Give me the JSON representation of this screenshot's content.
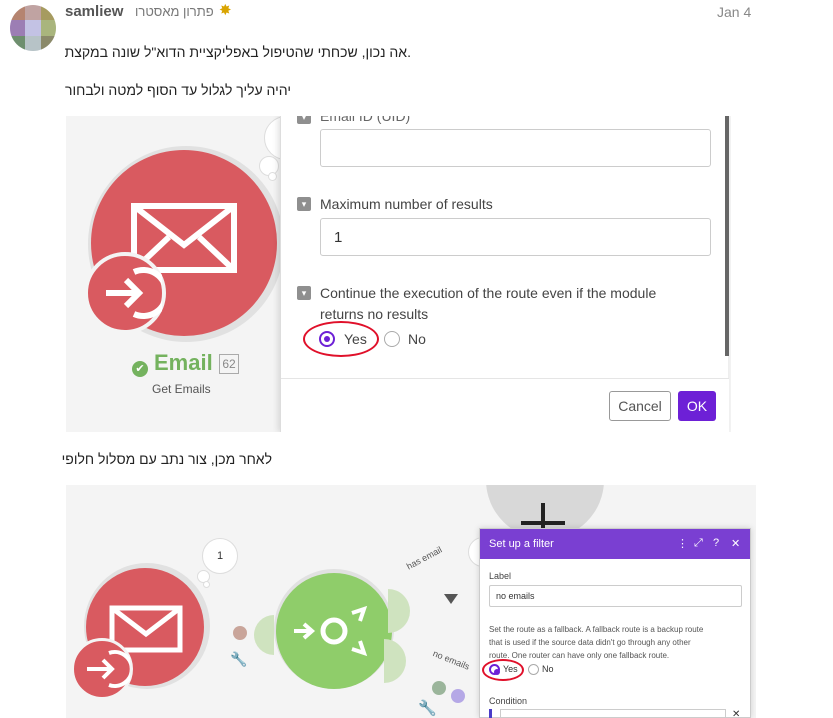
{
  "post": {
    "username": "samliew",
    "user_title": "פתרון מאסטרו",
    "date": "Jan 4",
    "avatar_colors": [
      "#b58470",
      "#c0a3a2",
      "#a69b60",
      "#9c7eb4",
      "#c3c2e4",
      "#a9b57d",
      "#6e8f6e",
      "#b7c3c7",
      "#8b8a6a"
    ],
    "text_1": ".אה נכון, שכחתי שהטיפול באפליקציית הדוא\"ל שונה במקצת",
    "text_2": "יהיה עליך לגלול עד הסוף למטה ולבחור",
    "text_3": "לאחר מכן, צור נתב עם מסלול חלופי"
  },
  "screenshot_1": {
    "module_name": "Email",
    "module_number": "62",
    "module_sub": "Get Emails",
    "field_top_label": "Email ID (UID)",
    "field_max_label": "Maximum number of results",
    "field_max_value": "1",
    "field_continue_label_1": "Continue the execution of the route even if the module",
    "field_continue_label_2": "returns no results",
    "radio_yes": "Yes",
    "radio_no": "No",
    "cancel_label": "Cancel",
    "ok_label": "OK",
    "accent": "#6d20d6"
  },
  "screenshot_2": {
    "bubble_number": "1",
    "route_label_1": "has email",
    "route_label_2": "no emails",
    "dialog_title": "Set up a filter",
    "label_field_label": "Label",
    "label_field_value": "no emails",
    "fallback_text_1": "Set the route as a fallback. A fallback route is a backup route",
    "fallback_text_2": "that is used if the source data didn't go through any other",
    "fallback_text_3": "route. One router can have only one fallback route.",
    "radio_yes": "Yes",
    "radio_no": "No",
    "condition_label": "Condition",
    "header_accent": "#7a3fd2"
  }
}
